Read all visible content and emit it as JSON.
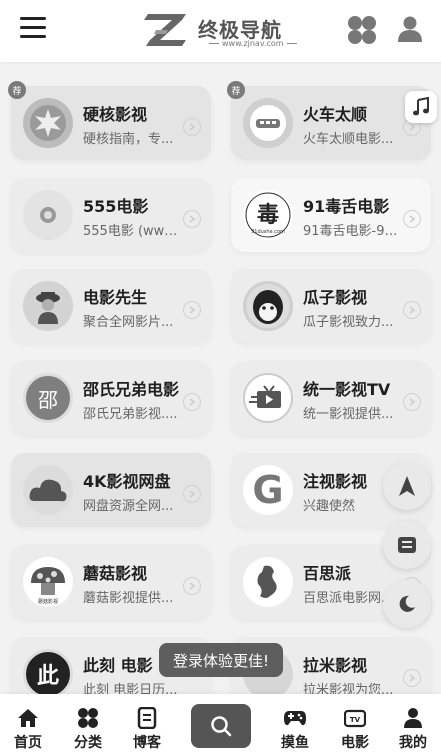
{
  "header": {
    "logo_text": "终极导航",
    "logo_url_text": "www.zjnav.com"
  },
  "cards": [
    {
      "title": "硬核影视",
      "desc": "硬核指南，专..."
    },
    {
      "title": "火车太顺",
      "desc": "火车太顺电影..."
    },
    {
      "title": "555电影",
      "desc": "555电影 (www...."
    },
    {
      "title": "91毒舌电影",
      "desc": "91毒舌电影-91..."
    },
    {
      "title": "电影先生",
      "desc": "聚合全网影片..."
    },
    {
      "title": "瓜子影视",
      "desc": "瓜子影视致力..."
    },
    {
      "title": "邵氏兄弟电影",
      "desc": "邵氏兄弟影视...."
    },
    {
      "title": "统一影视TV",
      "desc": "统一影视提供..."
    },
    {
      "title": "4K影视网盘",
      "desc": "网盘资源全网..."
    },
    {
      "title": "注视影视",
      "desc": "兴趣使然"
    },
    {
      "title": "蘑菇影视",
      "desc": "蘑菇影视提供..."
    },
    {
      "title": "百思派",
      "desc": "百思派电影网..."
    },
    {
      "title": "此刻 电影",
      "desc": "此刻 电影日历..."
    },
    {
      "title": "拉米影视",
      "desc": "拉米影视为您..."
    }
  ],
  "tags": {
    "recommend": "荐"
  },
  "avatars": {
    "shao": "邵",
    "ci": "此",
    "g": "G",
    "mogu_small": "蘑菇影视",
    "dushe_small": "91dushe.com"
  },
  "toast": "登录体验更佳!",
  "bottom_nav": [
    {
      "label": "首页",
      "icon": "home-icon"
    },
    {
      "label": "分类",
      "icon": "category-icon"
    },
    {
      "label": "博客",
      "icon": "blog-icon"
    },
    {
      "label": "",
      "icon": "search-icon"
    },
    {
      "label": "摸鱼",
      "icon": "gamepad-icon"
    },
    {
      "label": "电影",
      "icon": "tv-icon"
    },
    {
      "label": "我的",
      "icon": "user-icon"
    }
  ],
  "colors": {
    "header_bg": "#ffffff",
    "page_bg": "#f2f2f2",
    "card_bg": "#ececec",
    "toast_bg": "#5e5e5e",
    "search_bg": "#555555"
  }
}
